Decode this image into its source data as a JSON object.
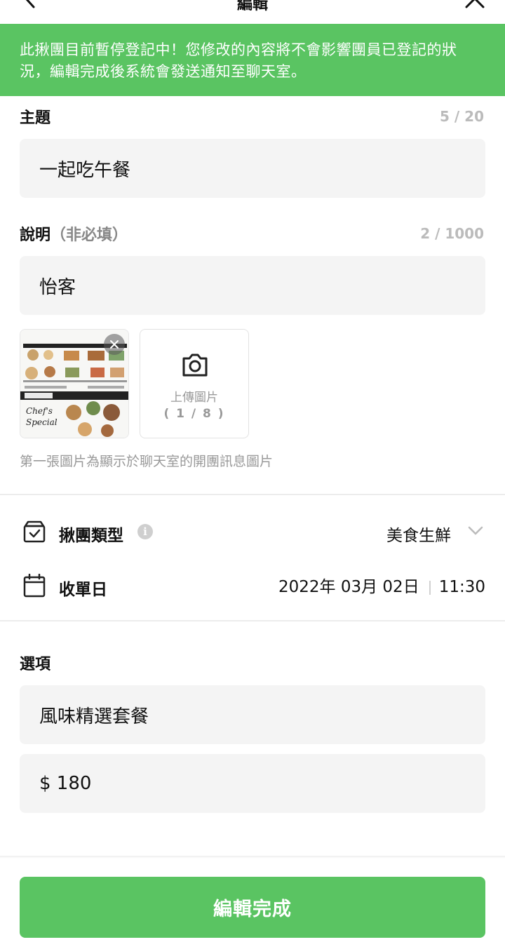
{
  "nav": {
    "title": "編輯"
  },
  "notice": {
    "text": "此揪團目前暫停登記中！您修改的內容將不會影響團員已登記的狀況，編輯完成後系統會發送通知至聊天室。"
  },
  "subject": {
    "label": "主題",
    "counter": "5 / 20",
    "value": "一起吃午餐"
  },
  "description": {
    "label": "說明",
    "optional_note": "（非必填）",
    "counter": "2 / 1000",
    "value": "怡客"
  },
  "images": {
    "thumbnail_icon": "menu-photo",
    "upload_label": "上傳圖片",
    "upload_count": "( 1 / 8 )",
    "hint": "第一張圖片為顯示於聊天室的開團訊息圖片"
  },
  "category": {
    "label": "揪團類型",
    "info": "i",
    "value": "美食生鮮"
  },
  "deadline": {
    "label": "收單日",
    "date": "2022年 03月 02日",
    "time": "11:30"
  },
  "options": {
    "label": "選項",
    "item_name": "風味精選套餐",
    "item_price": "$ 180"
  },
  "submit": {
    "label": "編輯完成"
  },
  "colors": {
    "accent": "#5ac462",
    "field_bg": "#f4f4f4",
    "muted_text": "#999999"
  }
}
